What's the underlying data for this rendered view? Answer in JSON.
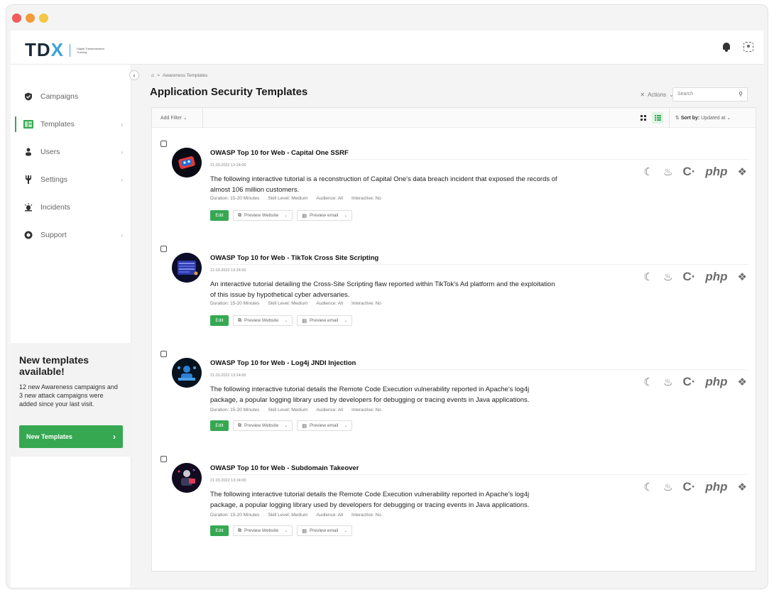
{
  "app": {
    "logo_main": "TD",
    "logo_x": "X",
    "logo_sub": "Digital Transformation Training"
  },
  "sidebar": {
    "collapse_icon": "chevron-left-icon",
    "items": [
      {
        "label": "Campaigns",
        "icon": "shield-icon",
        "has_chevron": false
      },
      {
        "label": "Templates",
        "icon": "templates-icon",
        "has_chevron": true,
        "active": true
      },
      {
        "label": "Users",
        "icon": "users-icon",
        "has_chevron": true
      },
      {
        "label": "Settings",
        "icon": "settings-icon",
        "has_chevron": true
      },
      {
        "label": "Incidents",
        "icon": "alert-icon",
        "has_chevron": false
      },
      {
        "label": "Support",
        "icon": "support-icon",
        "has_chevron": true
      }
    ],
    "promo": {
      "title": "New templates available!",
      "text": "12 new Awareness campaigns and 3 new attack campaigns were added since your last visit.",
      "button": "New Templates"
    }
  },
  "header": {
    "breadcrumb": "Awareness Templates",
    "breadcrumb_sep": ">",
    "title": "Application Security Templates",
    "actions_label": "Actions",
    "search_placeholder": "Search"
  },
  "toolbar": {
    "add_filter": "Add Filter",
    "sort_label": "Sort by:",
    "sort_value": "Updated at"
  },
  "templates": [
    {
      "title": "OWASP Top 10 for Web - Capital One SSRF",
      "date": "21.03.2022 13:24:00",
      "description": "The following interactive tutorial is a reconstruction of Capital One's data breach incident that exposed the records of almost 106 million customers.",
      "duration": "Duration: 15-20 Minutes",
      "skill": "Skill Level: Medium",
      "audience": "Audience: All",
      "interactive": "Interactive: No"
    },
    {
      "title": "OWASP Top 10 for Web - TikTok Cross Site Scripting",
      "date": "12.03.2022 13:24:00",
      "description": "An interactive tutorial detailing the Cross-Site Scripting flaw reported within TikTok's Ad platform and the exploitation of this issue by hypothetical cyber adversaries.",
      "duration": "Duration: 15-20 Minutes",
      "skill": "Skill Level: Medium",
      "audience": "Audience: All",
      "interactive": "Interactive: No"
    },
    {
      "title": "OWASP Top 10 for Web - Log4j JNDI Injection",
      "date": "21.03.2022 13:24:00",
      "description": "The following interactive tutorial details the Remote Code Execution vulnerability reported in Apache's log4j package, a popular logging library used by developers for debugging or tracing events in Java applications.",
      "duration": "Duration: 15-20 Minutes",
      "skill": "Skill Level: Medium",
      "audience": "Audience: All",
      "interactive": "Interactive: No"
    },
    {
      "title": "OWASP Top 10 for Web - Subdomain Takeover",
      "date": "21.03.2022 13:24:00",
      "description": "The following interactive tutorial details the Remote Code Execution vulnerability reported in Apache's log4j package, a popular logging library used by developers for debugging or tracing events in Java applications.",
      "duration": "Duration: 15-20 Minutes",
      "skill": "Skill Level: Medium",
      "audience": "Audience: All",
      "interactive": "Interactive: No"
    }
  ],
  "buttons": {
    "edit": "Edit",
    "preview_website": "Preview Website",
    "preview_email": "Preview email"
  },
  "languages": {
    "php": "php",
    "c": "C·"
  },
  "colors": {
    "accent_green": "#36a852",
    "logo_blue": "#3aa4d8"
  }
}
